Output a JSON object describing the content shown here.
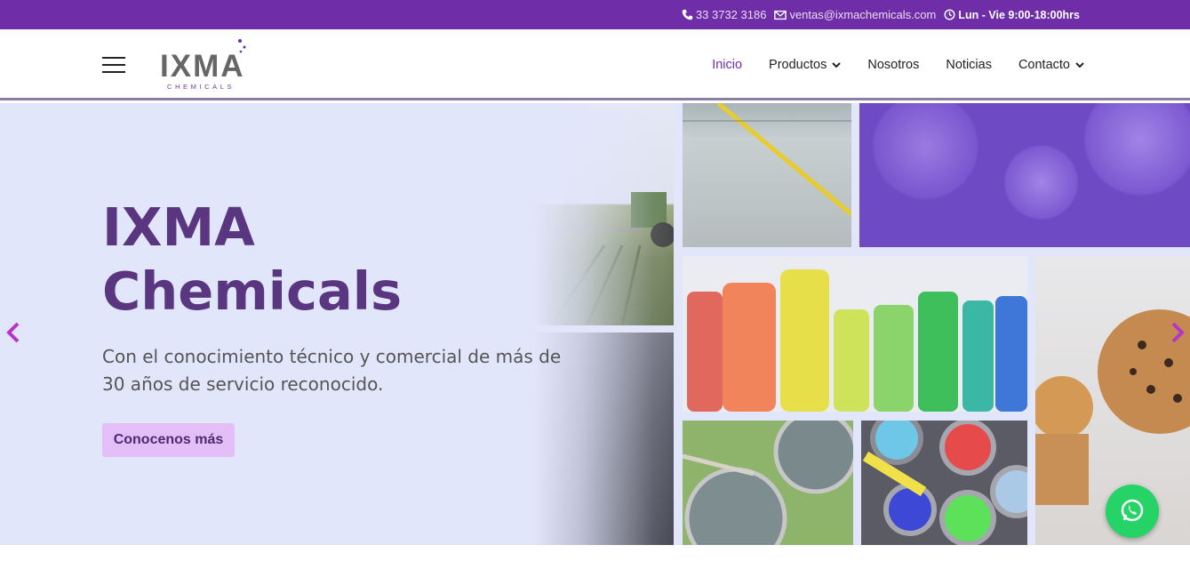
{
  "topbar": {
    "phone": "33 3732 3186",
    "email": "ventas@ixmachemicals.com",
    "hours": "Lun - Vie 9:00-18:00hrs",
    "icons": [
      "phone-icon",
      "envelope-icon",
      "clock-icon"
    ]
  },
  "logo": {
    "word": "IXMA",
    "sub": "CHEMICALS"
  },
  "nav": {
    "items": [
      {
        "label": "Inicio",
        "active": true
      },
      {
        "label": "Productos",
        "dropdown": true
      },
      {
        "label": "Nosotros"
      },
      {
        "label": "Noticias"
      },
      {
        "label": "Contacto",
        "dropdown": true
      }
    ]
  },
  "hero": {
    "title_line1": "IXMA",
    "title_line2": "Chemicals",
    "text": "Con el conocimiento técnico y comercial de más de 30 años de servicio reconocido.",
    "cta": "Conocenos más"
  },
  "colors": {
    "topbar": "#6f2da8",
    "accent": "#6f2da8",
    "hero_bg": "#e2e6fb",
    "title": "#5a3681",
    "cta_bg": "#e4bff7",
    "whatsapp": "#25d366"
  }
}
